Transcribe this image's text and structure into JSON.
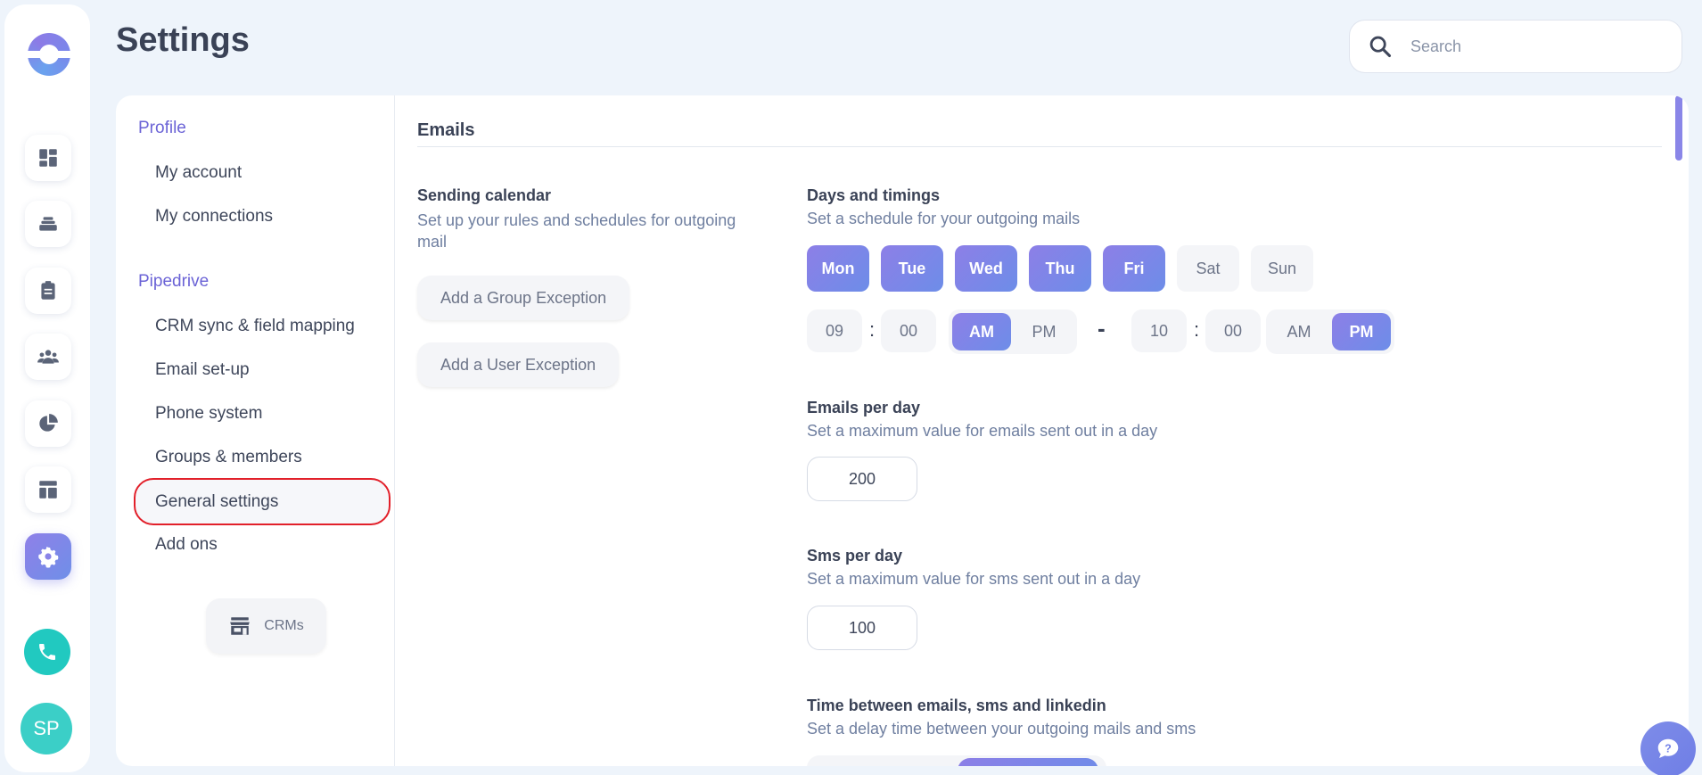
{
  "header": {
    "title": "Settings",
    "search_placeholder": "Search"
  },
  "rail": {
    "items": [
      "dashboard-icon",
      "stack-icon",
      "clipboard-icon",
      "team-icon",
      "pie-chart-icon",
      "layout-icon",
      "gear-icon"
    ],
    "active": "gear-icon",
    "avatar_initials": "SP",
    "colors": {
      "accent": "#8f80e8",
      "phone": "#21c9c0",
      "avatar": "#3bcfc7"
    }
  },
  "nav": {
    "sections": [
      {
        "title": "Profile",
        "items": [
          "My account",
          "My connections"
        ]
      },
      {
        "title": "Pipedrive",
        "items": [
          "CRM sync & field mapping",
          "Email set-up",
          "Phone system",
          "Groups & members",
          "General settings",
          "Add ons"
        ]
      }
    ],
    "active_item": "General settings",
    "crm_button": "CRMs"
  },
  "content": {
    "section_title": "Emails",
    "sending_calendar": {
      "title": "Sending calendar",
      "description": "Set up your rules and schedules for outgoing mail",
      "buttons": [
        "Add a Group Exception",
        "Add a User Exception"
      ]
    },
    "days_timings": {
      "title": "Days and timings",
      "description": "Set a schedule for your outgoing mails",
      "days": [
        {
          "label": "Mon",
          "on": true
        },
        {
          "label": "Tue",
          "on": true
        },
        {
          "label": "Wed",
          "on": true
        },
        {
          "label": "Thu",
          "on": true
        },
        {
          "label": "Fri",
          "on": true
        },
        {
          "label": "Sat",
          "on": false
        },
        {
          "label": "Sun",
          "on": false
        }
      ],
      "start": {
        "hour": "09",
        "minute": "00",
        "am": "AM",
        "pm": "PM",
        "selected": "AM"
      },
      "separator": "-",
      "end": {
        "hour": "10",
        "minute": "00",
        "am": "AM",
        "pm": "PM",
        "selected": "PM"
      }
    },
    "emails_per_day": {
      "title": "Emails per day",
      "description": "Set a maximum value for emails sent out in a day",
      "value": "200"
    },
    "sms_per_day": {
      "title": "Sms per day",
      "description": "Set a maximum value for sms sent out in a day",
      "value": "100"
    },
    "delay": {
      "title": "Time between emails, sms and linkedin",
      "description": "Set a delay time between your outgoing mails and sms"
    }
  }
}
